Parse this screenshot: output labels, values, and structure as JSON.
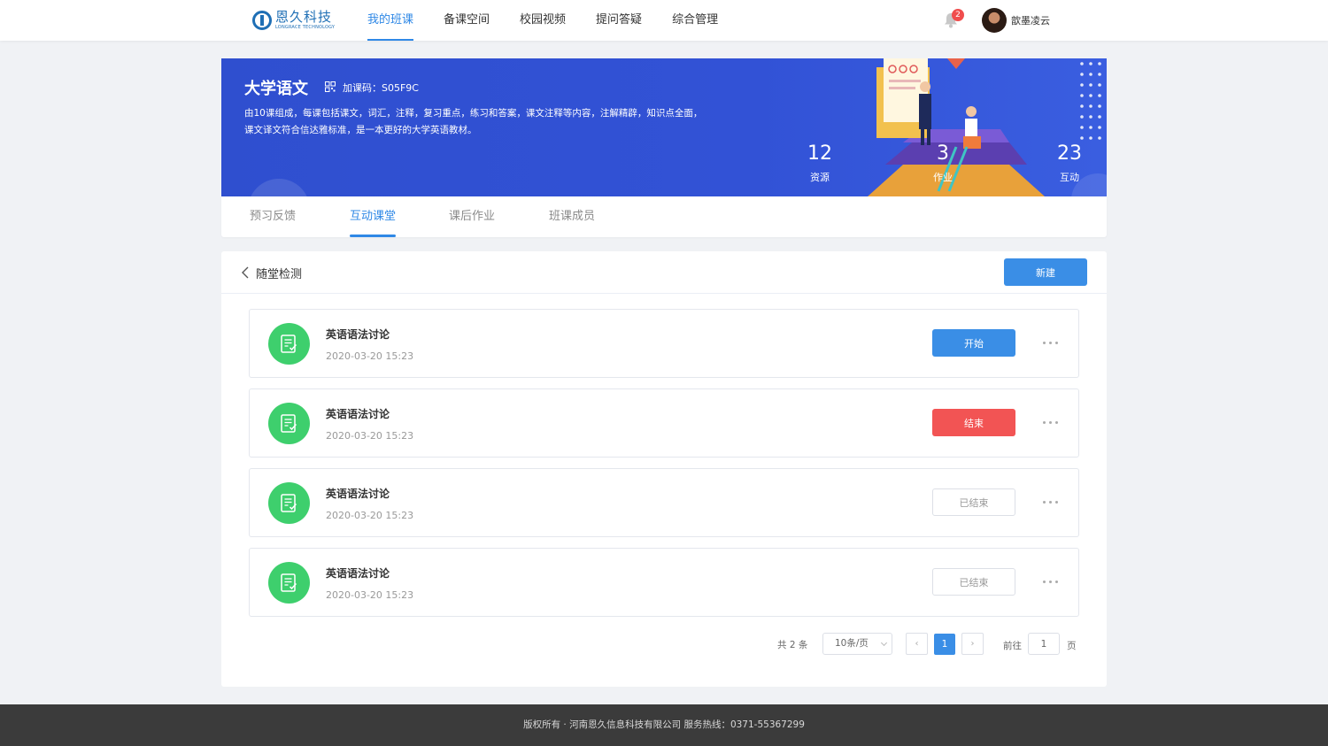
{
  "header": {
    "logo_cn": "恩久科技",
    "logo_en": "LONGRACE TECHNOLOGY",
    "nav": [
      {
        "label": "我的班课",
        "active": true
      },
      {
        "label": "备课空间",
        "active": false
      },
      {
        "label": "校园视频",
        "active": false
      },
      {
        "label": "提问答疑",
        "active": false
      },
      {
        "label": "综合管理",
        "active": false
      }
    ],
    "notification_count": "2",
    "username": "歆墨凌云"
  },
  "banner": {
    "title": "大学语文",
    "join_code_label": "加课码：S05F9C",
    "description": "由10课组成，每课包括课文，词汇，注释，复习重点，练习和答案，课文注释等内容，注解精辟，知识点全面，课文译文符合信达雅标准，是一本更好的大学英语教材。",
    "stats": [
      {
        "value": "12",
        "label": "资源"
      },
      {
        "value": "3",
        "label": "作业"
      },
      {
        "value": "23",
        "label": "互动"
      }
    ]
  },
  "tabs": [
    {
      "label": "预习反馈",
      "active": false
    },
    {
      "label": "互动课堂",
      "active": true
    },
    {
      "label": "课后作业",
      "active": false
    },
    {
      "label": "班课成员",
      "active": false
    }
  ],
  "section": {
    "title": "随堂检测",
    "new_label": "新建"
  },
  "items": [
    {
      "title": "英语语法讨论",
      "time": "2020-03-20  15:23",
      "action": "开始",
      "status": "start"
    },
    {
      "title": "英语语法讨论",
      "time": "2020-03-20  15:23",
      "action": "结束",
      "status": "end"
    },
    {
      "title": "英语语法讨论",
      "time": "2020-03-20  15:23",
      "action": "已结束",
      "status": "done"
    },
    {
      "title": "英语语法讨论",
      "time": "2020-03-20  15:23",
      "action": "已结束",
      "status": "done"
    }
  ],
  "pagination": {
    "total": "共 2 条",
    "page_size": "10条/页",
    "prev": "‹",
    "next": "›",
    "current": "1",
    "goto_label": "前往",
    "goto_value": "1",
    "goto_suffix": "页"
  },
  "footer": {
    "text": "版权所有 · 河南恩久信息科技有限公司   服务热线：0371-55367299"
  },
  "colors": {
    "primary": "#3a8ee6",
    "danger": "#f25454",
    "success": "#3ecf6d",
    "banner": "#3252d6"
  }
}
